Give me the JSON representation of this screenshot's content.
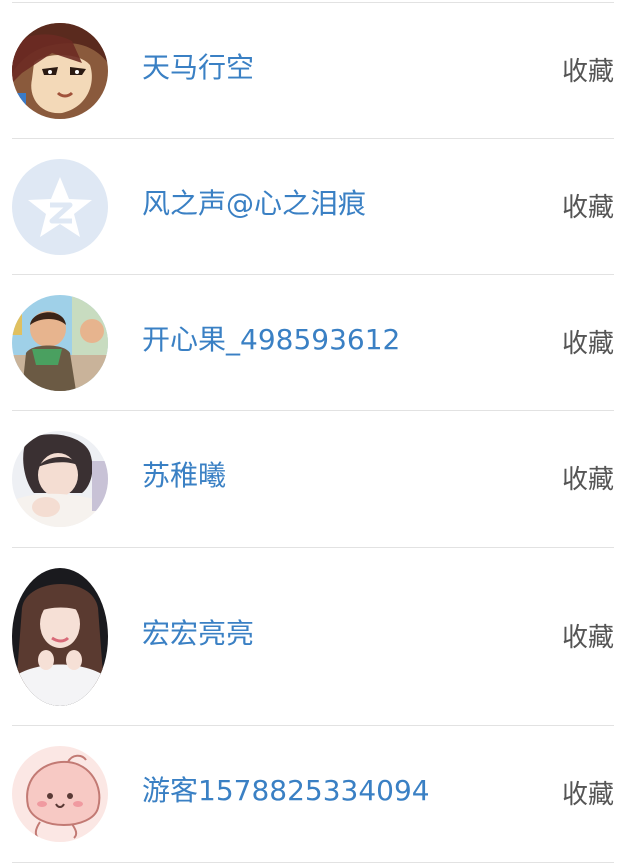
{
  "list": {
    "items": [
      {
        "avatar": "anime-boy-avatar-icon",
        "name": "天马行空",
        "action_label": "收藏"
      },
      {
        "avatar": "qq-star-default-avatar-icon",
        "name": "风之声@心之泪痕",
        "action_label": "收藏"
      },
      {
        "avatar": "child-photo-avatar",
        "name": "开心果_498593612",
        "action_label": "收藏"
      },
      {
        "avatar": "woman-photo-avatar",
        "name": "苏稚曦",
        "action_label": "收藏"
      },
      {
        "avatar": "girl-photo-avatar",
        "name": "宏宏亮亮",
        "action_label": "收藏"
      },
      {
        "avatar": "pink-cartoon-avatar-icon",
        "name": "游客1578825334094",
        "action_label": "收藏"
      }
    ]
  },
  "colors": {
    "name_link": "#3a80c4",
    "action_text": "#555555",
    "divider": "#e2e2e2"
  }
}
